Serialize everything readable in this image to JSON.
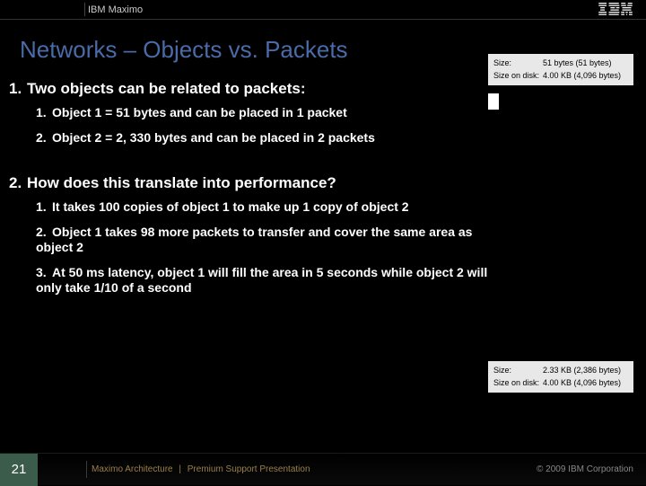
{
  "header": {
    "product": "IBM Maximo",
    "logo_alt": "IBM"
  },
  "title": "Networks – Objects vs. Packets",
  "points": {
    "p1": {
      "num": "1.",
      "text": "Two objects can be related to packets:"
    },
    "p1_1": {
      "num": "1.",
      "text": "Object 1 = 51 bytes and can be placed in 1 packet"
    },
    "p1_2": {
      "num": "2.",
      "text": "Object 2 = 2, 330 bytes and can be placed in 2 packets"
    },
    "p2": {
      "num": "2.",
      "text": "How does this translate into performance?"
    },
    "p2_1": {
      "num": "1.",
      "text": "It takes 100 copies of object 1 to make up 1 copy of object 2"
    },
    "p2_2": {
      "num": "2.",
      "text": "Object 1 takes 98 more packets to transfer and cover the same area as object 2"
    },
    "p2_3": {
      "num": "3.",
      "text": "At 50 ms latency, object 1 will fill the area in 5 seconds while object 2 will only take 1/10 of a second"
    }
  },
  "file_info_top": {
    "size_label": "Size:",
    "size_value": "51 bytes (51 bytes)",
    "disk_label": "Size on disk:",
    "disk_value": "4.00 KB (4,096 bytes)"
  },
  "file_info_bot": {
    "size_label": "Size:",
    "size_value": "2.33 KB (2,386 bytes)",
    "disk_label": "Size on disk:",
    "disk_value": "4.00 KB (4,096 bytes)"
  },
  "footer": {
    "page": "21",
    "left": "Maximo Architecture",
    "sep": "|",
    "right": "Premium Support Presentation",
    "copyright": "© 2009 IBM Corporation"
  }
}
